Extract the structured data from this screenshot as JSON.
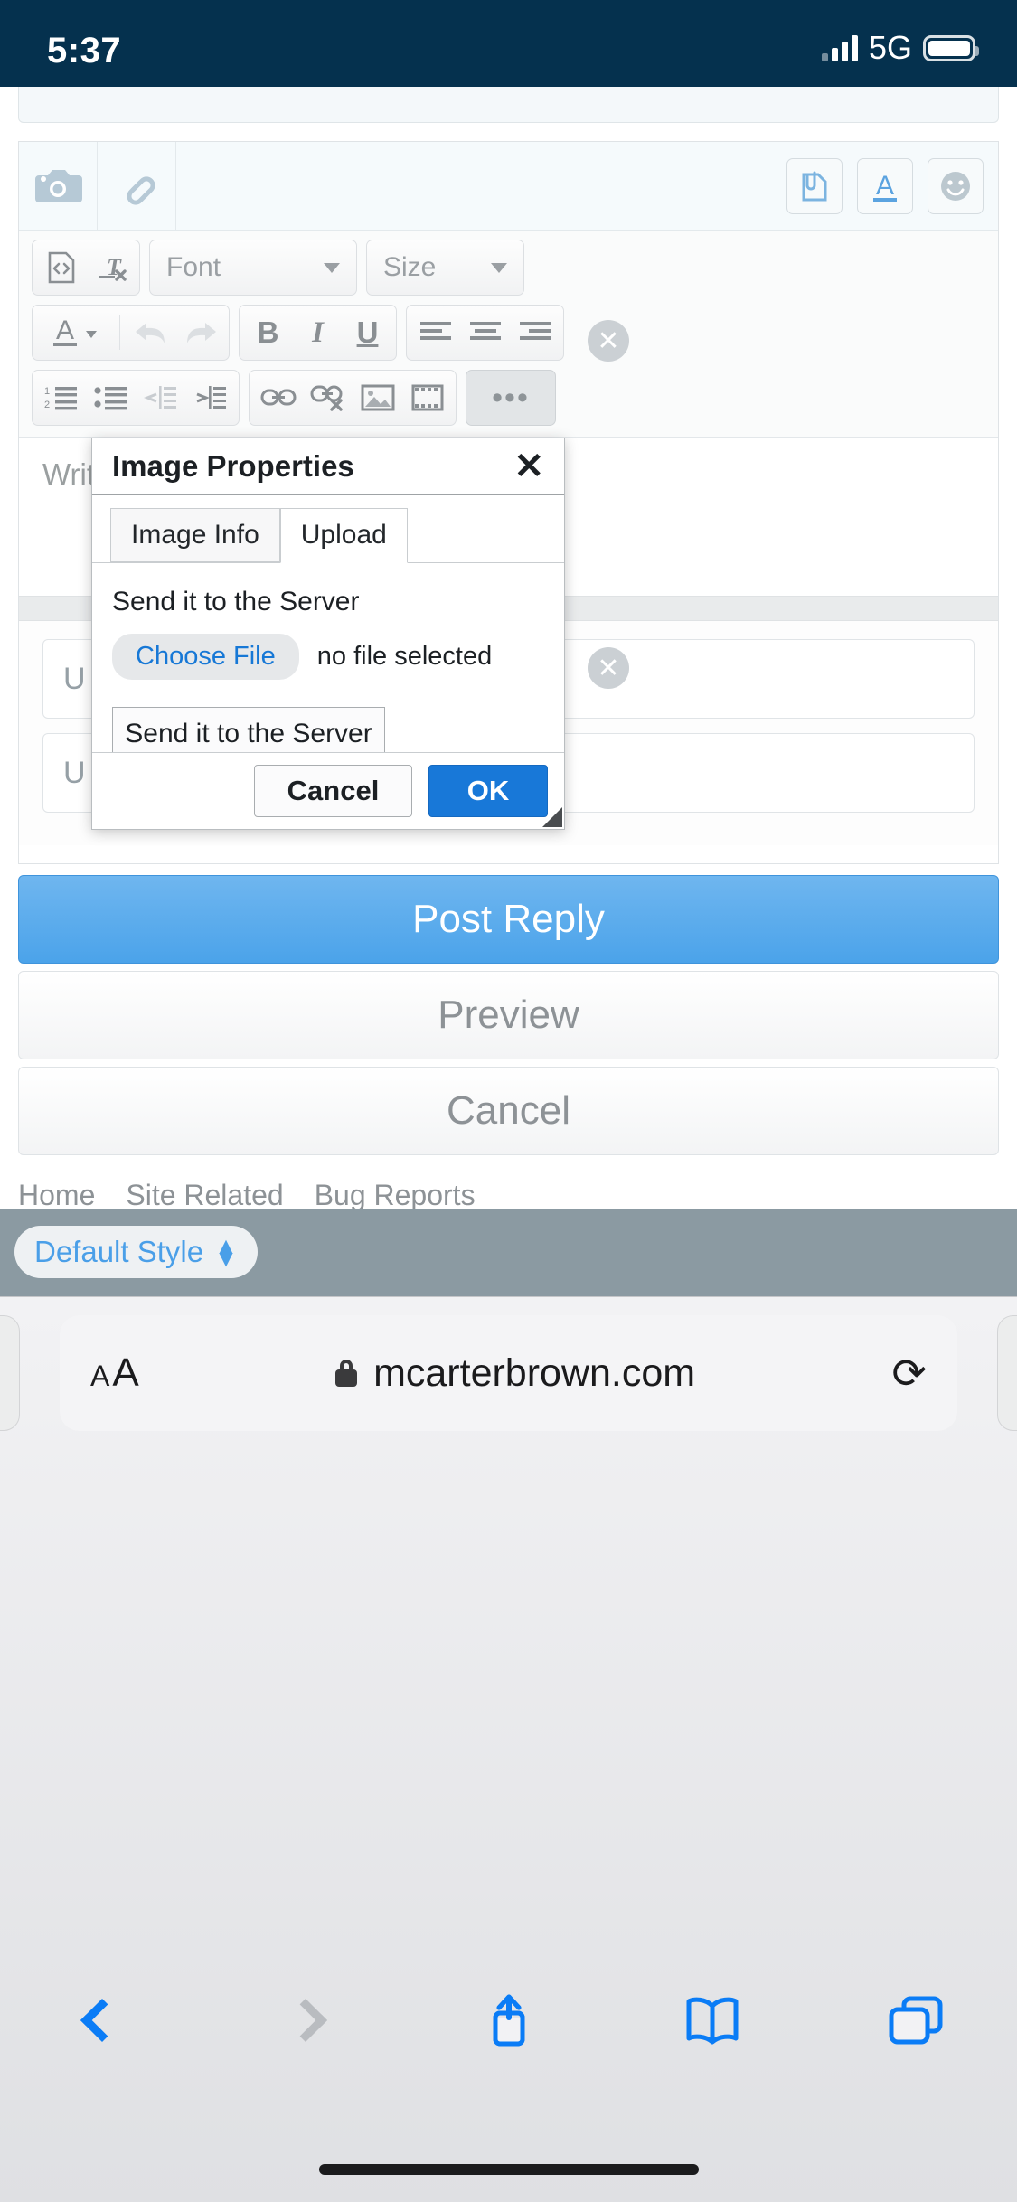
{
  "status_bar": {
    "time": "5:37",
    "network": "5G",
    "signal_icon": "cellular-bars-icon",
    "battery_icon": "battery-icon"
  },
  "editor": {
    "quick_tools": [
      {
        "name": "camera-icon",
        "label": "Camera"
      },
      {
        "name": "link-icon",
        "label": "Link"
      }
    ],
    "quick_tools_right": [
      {
        "name": "attachment-tag-icon",
        "label": "Attach"
      },
      {
        "name": "font-color-icon",
        "label": "A"
      },
      {
        "name": "smiley-icon",
        "label": "Smiley"
      }
    ],
    "row1": {
      "source_icon": "source-code-icon",
      "remove_format_icon": "remove-format-icon",
      "font_select": "Font",
      "size_select": "Size"
    },
    "row2": {
      "text_color_label": "A",
      "undo_icon": "undo-icon",
      "redo_icon": "redo-icon",
      "bold_label": "B",
      "italic_label": "I",
      "underline_label": "U",
      "align_left_icon": "align-left-icon",
      "align_center_icon": "align-center-icon",
      "align_right_icon": "align-right-icon"
    },
    "row3": {
      "numbered_list_icon": "numbered-list-icon",
      "bullet_list_icon": "bullet-list-icon",
      "outdent_icon": "outdent-icon",
      "indent_icon": "indent-icon",
      "link_icon": "link-icon",
      "unlink_icon": "unlink-icon",
      "image_icon": "image-icon",
      "video_icon": "video-icon",
      "more_label": "•••"
    },
    "body_placeholder": "Write",
    "lower_field_1": "U",
    "lower_field_2": "U"
  },
  "dialog": {
    "title": "Image Properties",
    "close_icon": "close-icon",
    "tabs": [
      {
        "label": "Image Info",
        "active": false
      },
      {
        "label": "Upload",
        "active": true
      }
    ],
    "section_label": "Send it to the Server",
    "choose_file_label": "Choose File",
    "file_status": "no file selected",
    "send_button_label": "Send it to the Server",
    "cancel_label": "Cancel",
    "ok_label": "OK"
  },
  "actions": {
    "post_reply": "Post Reply",
    "preview": "Preview",
    "cancel": "Cancel"
  },
  "footer": {
    "links": [
      "Home",
      "Site Related",
      "Bug Reports"
    ],
    "style_selector": "Default Style"
  },
  "browser": {
    "text_size_small": "A",
    "text_size_large": "A",
    "lock_icon": "lock-icon",
    "domain": "mcarterbrown.com",
    "reload_icon": "reload-icon",
    "back_icon": "back-chevron-icon",
    "forward_icon": "forward-chevron-icon",
    "share_icon": "share-icon",
    "bookmarks_icon": "book-icon",
    "tabs_icon": "tabs-icon"
  },
  "colors": {
    "status_bar_bg": "#05314e",
    "accent_blue": "#1878d8",
    "link_blue": "#0a7cf6",
    "post_button": "#4ba3ea"
  }
}
